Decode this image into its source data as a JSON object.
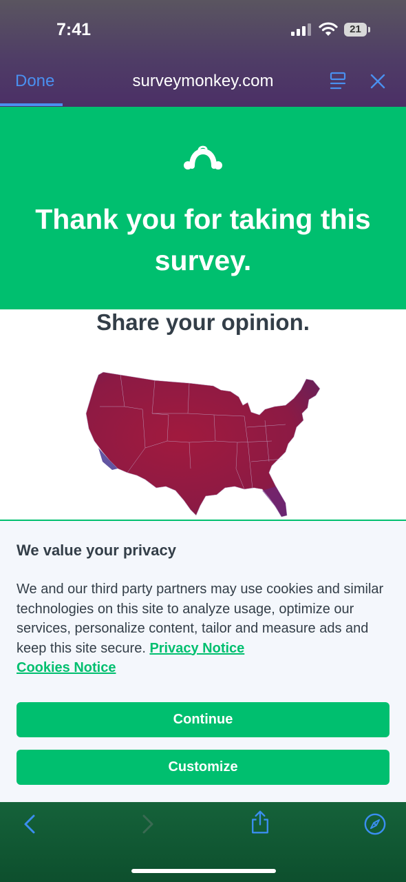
{
  "status": {
    "time": "7:41",
    "battery": "21"
  },
  "browser": {
    "done_label": "Done",
    "url": "surveymonkey.com"
  },
  "hero": {
    "title": "Thank you for taking this survey."
  },
  "content": {
    "share_heading": "Share your opinion."
  },
  "privacy": {
    "title": "We value your privacy",
    "body": "We and our third party partners may use cookies and similar technologies on this site to analyze usage, optimize our services, personalize content, tailor and measure ads and keep this site secure.",
    "privacy_link": "Privacy Notice",
    "cookies_link": "Cookies Notice",
    "continue_label": "Continue",
    "customize_label": "Customize"
  },
  "toolbar": {
    "icons": [
      "back-icon",
      "forward-icon",
      "share-icon",
      "compass-icon"
    ]
  },
  "colors": {
    "brand_green": "#00bf6f",
    "browser_accent": "#4a90f0",
    "text_dark": "#333e48",
    "map_red": "#9a1a3c",
    "map_blue": "#3b2a8a"
  }
}
